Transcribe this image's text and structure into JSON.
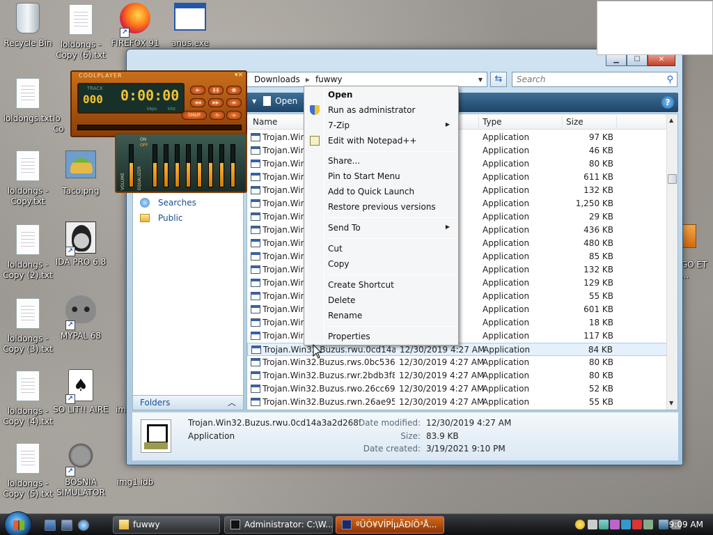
{
  "desktop": {
    "icons": [
      {
        "label": "Recycle Bin"
      },
      {
        "label": "loldongs - Copy (6).txt"
      },
      {
        "label": "FIREFOX 91"
      },
      {
        "label": "anus.exe"
      },
      {
        "label": "loldongs.txt"
      },
      {
        "label": "lo Co"
      },
      {
        "label": "loldongs - Copy.txt"
      },
      {
        "label": "Taco.png"
      },
      {
        "label": "loldongs - Copy (2).txt"
      },
      {
        "label": "IDA PRO 6.8"
      },
      {
        "label": "loldongs - Copy (3).txt"
      },
      {
        "label": "MYPAL 68"
      },
      {
        "label": "loldongs - Copy (4).txt"
      },
      {
        "label": "SO LIT!! AIRE"
      },
      {
        "label": "loldongs - Copy (5).txt"
      },
      {
        "label": "BOSNIA SIMULATOR"
      },
      {
        "label": "img1.idb"
      },
      {
        "label": "im"
      },
      {
        "label": "GO ET ..."
      }
    ]
  },
  "explorer": {
    "breadcrumb": [
      "Downloads",
      "fuwwy"
    ],
    "search_placeholder": "Search",
    "toolbar": {
      "open_label": "Open"
    },
    "nav": {
      "searches": "Searches",
      "public": "Public",
      "folders": "Folders"
    },
    "columns": {
      "name": "Name",
      "type": "Type",
      "size": "Size"
    },
    "rows": [
      {
        "name": "Trojan.Win3",
        "date": "AM",
        "type": "Application",
        "size": "97 KB"
      },
      {
        "name": "Trojan.Win3",
        "date": "AM",
        "type": "Application",
        "size": "46 KB"
      },
      {
        "name": "Trojan.Win3",
        "date": "AM",
        "type": "Application",
        "size": "80 KB"
      },
      {
        "name": "Trojan.Win3",
        "date": "AM",
        "type": "Application",
        "size": "611 KB"
      },
      {
        "name": "Trojan.Win3",
        "date": "AM",
        "type": "Application",
        "size": "132 KB"
      },
      {
        "name": "Trojan.Win3",
        "date": "AM",
        "type": "Application",
        "size": "1,250 KB"
      },
      {
        "name": "Trojan.Win3",
        "date": "AM",
        "type": "Application",
        "size": "29 KB"
      },
      {
        "name": "Trojan.Win3",
        "date": "AM",
        "type": "Application",
        "size": "436 KB"
      },
      {
        "name": "Trojan.Win3",
        "date": "AM",
        "type": "Application",
        "size": "480 KB"
      },
      {
        "name": "Trojan.Win3",
        "date": "AM",
        "type": "Application",
        "size": "85 KB"
      },
      {
        "name": "Trojan.Win3",
        "date": "AM",
        "type": "Application",
        "size": "132 KB"
      },
      {
        "name": "Trojan.Win3",
        "date": "AM",
        "type": "Application",
        "size": "129 KB"
      },
      {
        "name": "Trojan.Win3",
        "date": "AM",
        "type": "Application",
        "size": "55 KB"
      },
      {
        "name": "Trojan.Win3",
        "date": "AM",
        "type": "Application",
        "size": "601 KB"
      },
      {
        "name": "Trojan.Win3",
        "date": "AM",
        "type": "Application",
        "size": "18 KB"
      },
      {
        "name": "Trojan.Win3",
        "date": "AM",
        "type": "Application",
        "size": "117 KB"
      },
      {
        "name": "Trojan.Win32.Buzus.rwu.0cd14a3...",
        "date": "12/30/2019 4:27 AM",
        "type": "Application",
        "size": "84 KB"
      },
      {
        "name": "Trojan.Win32.Buzus.rws.0bc5368d...",
        "date": "12/30/2019 4:27 AM",
        "type": "Application",
        "size": "80 KB"
      },
      {
        "name": "Trojan.Win32.Buzus.rwr.2bdb3f81...",
        "date": "12/30/2019 4:27 AM",
        "type": "Application",
        "size": "80 KB"
      },
      {
        "name": "Trojan.Win32.Buzus.rwo.26cc6924...",
        "date": "12/30/2019 4:27 AM",
        "type": "Application",
        "size": "52 KB"
      },
      {
        "name": "Trojan.Win32.Buzus.rwn.26ae959a...",
        "date": "12/30/2019 4:27 AM",
        "type": "Application",
        "size": "55 KB"
      }
    ],
    "details": {
      "filename": "Trojan.Win32.Buzus.rwu.0cd14a3a2d268f...",
      "type": "Application",
      "modified_label": "Date modified:",
      "modified": "12/30/2019 4:27 AM",
      "size_label": "Size:",
      "size": "83.9 KB",
      "created_label": "Date created:",
      "created": "3/19/2021 9:10 PM"
    }
  },
  "player": {
    "title": "COOLPLAYER",
    "track_label": "TRACK",
    "track": "000",
    "time": "0:00:00",
    "kbps": "kbps",
    "khz": "kHz",
    "shuf": "SHUF",
    "on": "ON",
    "off": "OFF",
    "volume": "VOLUME",
    "equalizer": "EQUALIZER"
  },
  "context_menu": {
    "items": [
      "Open",
      "Run as administrator",
      "7-Zip",
      "Edit with Notepad++",
      "Share...",
      "Pin to Start Menu",
      "Add to Quick Launch",
      "Restore previous versions",
      "Send To",
      "Cut",
      "Copy",
      "Create Shortcut",
      "Delete",
      "Rename",
      "Properties"
    ]
  },
  "taskbar": {
    "buttons": [
      "fuwwy",
      "Administrator: C:\\W...",
      "ºÜÓ¥VÍPÍµÄÐíÖ³Å..."
    ],
    "clock": "9:09 AM"
  }
}
